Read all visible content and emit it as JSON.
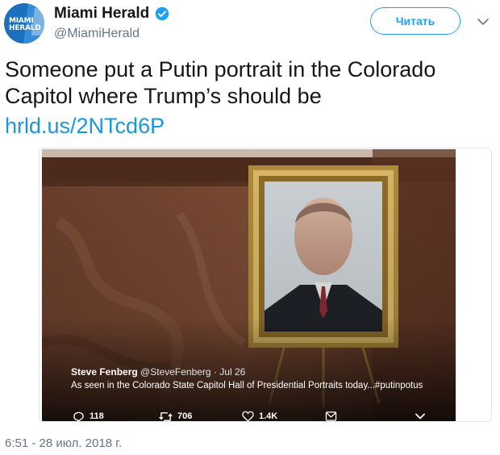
{
  "account": {
    "avatar_text_line1": "MIAMI",
    "avatar_text_line2": "HERALD",
    "name": "Miami Herald",
    "handle": "@MiamiHerald",
    "follow_label": "Читать"
  },
  "tweet": {
    "text": "Someone put a Putin portrait in the Colorado Capitol where Trump’s should be",
    "link": "hrld.us/2NTcd6P",
    "timestamp": "6:51 - 28 июл. 2018 г."
  },
  "embedded": {
    "author_name": "Steve Fenberg",
    "author_handle_date": "@SteveFenberg · Jul 26",
    "text": "As seen in the Colorado State Capitol Hall of Presidential Portraits today...#putinpotus",
    "reply_count": "118",
    "retweet_count": "706",
    "like_count": "1.4K"
  },
  "colors": {
    "accent": "#1da1f2",
    "link": "#1b95e0",
    "verified": "#1da1f2",
    "secondary_text": "#657786"
  }
}
